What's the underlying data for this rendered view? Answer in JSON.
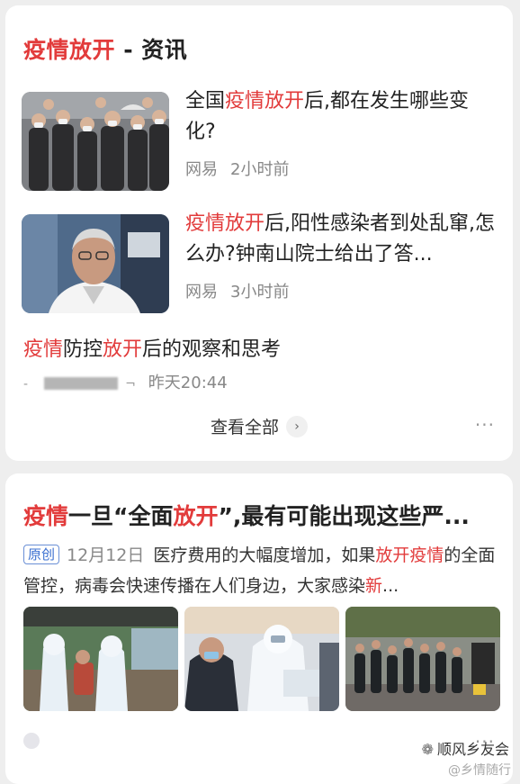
{
  "card1": {
    "section_title_hl": "疫情放开",
    "section_title_rest": " - 资讯",
    "items": [
      {
        "title_pre": "全国",
        "title_hl": "疫情放开",
        "title_post": "后,都在发生哪些变化?",
        "source": "网易",
        "time": "2小时前"
      },
      {
        "title_pre": "",
        "title_hl": "疫情放开",
        "title_post": "后,阳性感染者到处乱窜,怎么办?钟南山院士给出了答...",
        "source": "网易",
        "time": "3小时前"
      }
    ],
    "text_item": {
      "part1_hl": "疫情",
      "part2": "防控",
      "part3_hl": "放开",
      "part4": "后的观察和思考",
      "time": "昨天20:44"
    },
    "view_all": "查看全部",
    "more": "···"
  },
  "card2": {
    "title_hl1": "疫情",
    "title_mid": "一旦“全面",
    "title_hl2": "放开",
    "title_post": "”,最有可能出现这些严...",
    "badge": "原创",
    "date": "12月12日",
    "snippet_pre": "医疗费用的大幅度增加，如果",
    "snippet_hl": "放开疫情",
    "snippet_mid": "的全面管控，病毒会快速传播在人们身边，大家感染",
    "snippet_hl2": "新",
    "snippet_end": "...",
    "more": "···"
  },
  "watermark": {
    "text": "顺风乡友会",
    "sub": "@乡情随行"
  },
  "colors": {
    "highlight": "#e23b3b",
    "badge": "#3a6fd0"
  }
}
